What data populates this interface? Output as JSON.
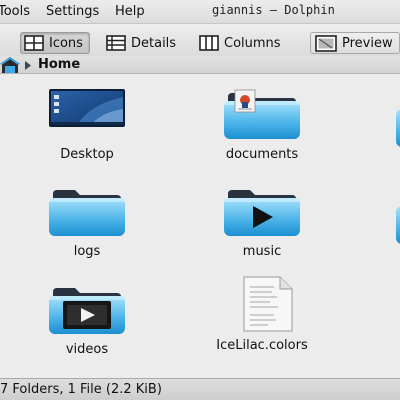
{
  "window": {
    "title": "giannis – Dolphin"
  },
  "menubar": {
    "items": [
      "Tools",
      "Settings",
      "Help"
    ]
  },
  "toolbar": {
    "view_modes": [
      {
        "label": "Icons",
        "icon": "icons-view-icon",
        "active": true
      },
      {
        "label": "Details",
        "icon": "details-view-icon",
        "active": false
      },
      {
        "label": "Columns",
        "icon": "columns-view-icon",
        "active": false
      }
    ],
    "preview": {
      "label": "Preview",
      "icon": "preview-icon"
    }
  },
  "breadcrumb": {
    "home_label": "Home",
    "icons": [
      "home-icon",
      "arrow-right-icon"
    ]
  },
  "files": [
    {
      "name": "Desktop",
      "icon": "desktop-folder-icon"
    },
    {
      "name": "documents",
      "icon": "documents-folder-icon"
    },
    {
      "name": "logs",
      "icon": "folder-icon"
    },
    {
      "name": "music",
      "icon": "music-folder-icon"
    },
    {
      "name": "videos",
      "icon": "videos-folder-icon"
    },
    {
      "name": "IceLilac.colors",
      "icon": "text-file-icon"
    }
  ],
  "status": {
    "text": "7 Folders, 1 File (2.2 KiB)"
  },
  "colors": {
    "folder_light": "#8fd4f5",
    "folder_dark": "#1b8fd0",
    "folder_tab": "#2a3440",
    "background": "#ececec"
  }
}
